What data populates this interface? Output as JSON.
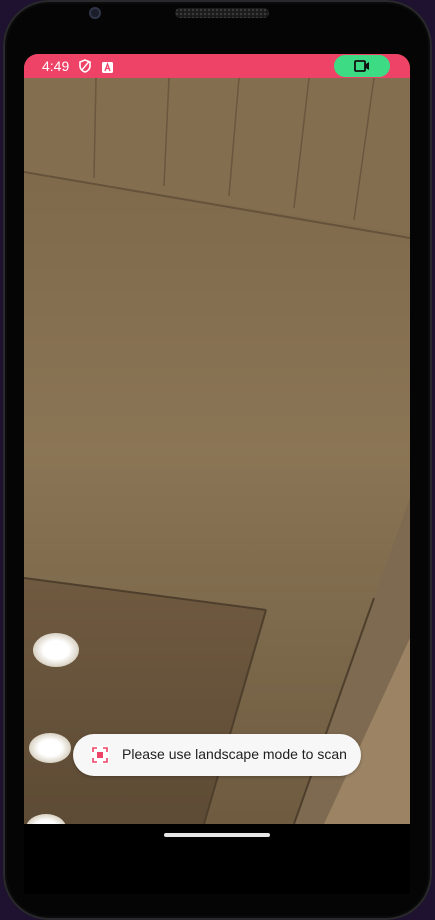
{
  "status_bar": {
    "time": "4:49",
    "icons": [
      "shield-icon",
      "a-badge-icon"
    ],
    "background_color": "#ee4266",
    "recording_indicator": {
      "icon": "videocam-icon",
      "color": "#3ddc84"
    }
  },
  "camera_preview": {
    "scene": "ceiling-camera-feed"
  },
  "toast": {
    "icon": "scan-icon",
    "message": "Please use landscape mode to scan"
  },
  "navigation": {
    "home_indicator": "home-gesture-bar"
  }
}
